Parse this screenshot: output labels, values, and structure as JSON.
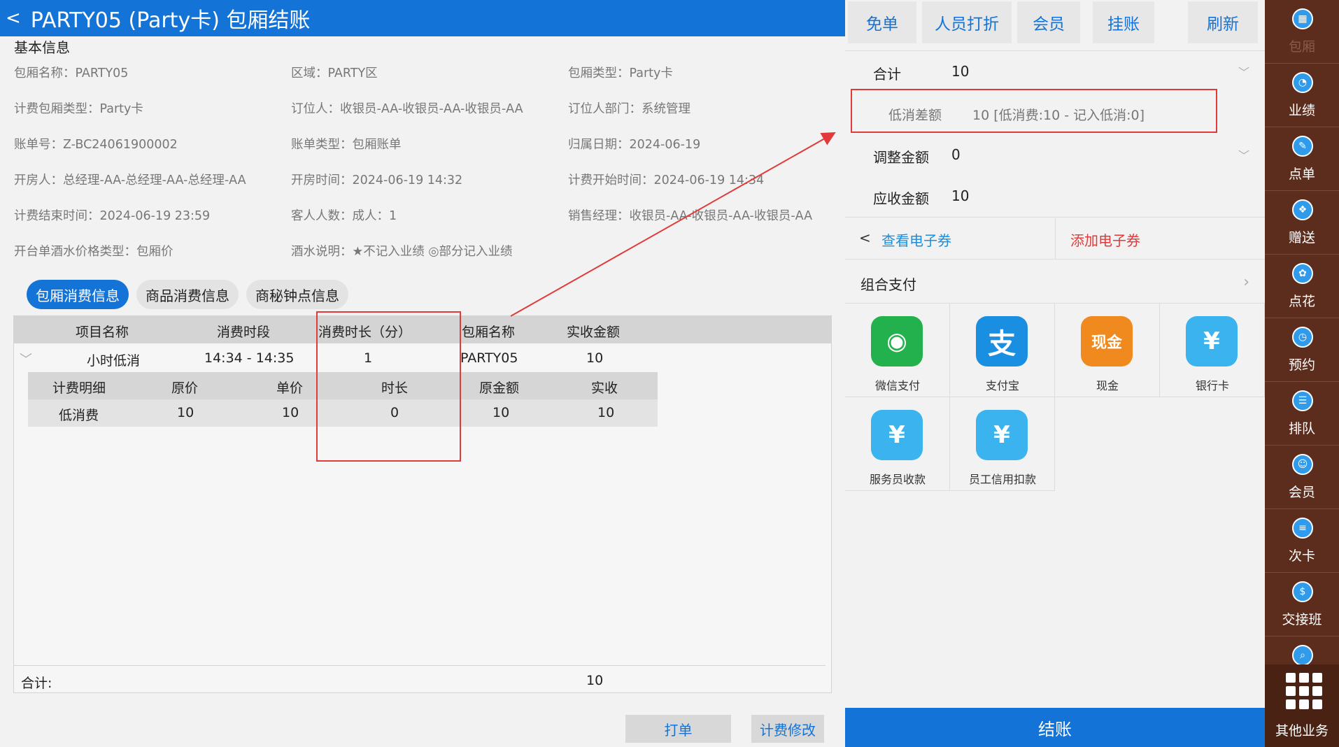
{
  "header": {
    "title": "PARTY05 (Party卡) 包厢结账"
  },
  "basic": {
    "section": "基本信息",
    "fields": [
      "包厢名称：PARTY05",
      "区域：PARTY区",
      "包厢类型：Party卡",
      "计费包厢类型：Party卡",
      "订位人：收银员-AA-收银员-AA-收银员-AA",
      "订位人部门：系统管理",
      "账单号：Z-BC24061900002",
      "账单类型：包厢账单",
      "归属日期：2024-06-19",
      "开房人：总经理-AA-总经理-AA-总经理-AA",
      "开房时间：2024-06-19 14:32",
      "计费开始时间：2024-06-19 14:34",
      "计费结束时间：2024-06-19 23:59",
      "客人人数：成人：1",
      "销售经理：收银员-AA-收银员-AA-收银员-AA",
      "开台单酒水价格类型：包厢价",
      "酒水说明：★不记入业绩 ◎部分记入业绩"
    ]
  },
  "tabs": [
    "包厢消费信息",
    "商品消费信息",
    "商秘钟点信息"
  ],
  "table": {
    "headers": [
      "项目名称",
      "消费时段",
      "消费时长（分）",
      "包厢名称",
      "实收金额"
    ],
    "row": [
      "小时低消",
      "14:34 - 14:35",
      "1",
      "PARTY05",
      "10"
    ],
    "sub_headers": [
      "计费明细",
      "原价",
      "单价",
      "时长",
      "原金额",
      "实收"
    ],
    "sub_row": [
      "低消费",
      "10",
      "10",
      "0",
      "10",
      "10"
    ],
    "total_label": "合计:",
    "total_value": "10"
  },
  "buttons": {
    "print": "打单",
    "modify": "计费修改"
  },
  "right": {
    "top_buttons": [
      "免单",
      "人员打折",
      "会员",
      "挂账",
      "刷新"
    ],
    "total_label": "合计",
    "total_value": "10",
    "diff_label": "低消差额",
    "diff_value": "10 [低消费:10 - 记入低消:0]",
    "adjust_label": "调整金额",
    "adjust_value": "0",
    "receivable_label": "应收金额",
    "receivable_value": "10",
    "view_coupon": "查看电子券",
    "add_coupon": "添加电子券",
    "combo_pay": "组合支付",
    "payments": [
      {
        "label": "微信支付",
        "color": "#22b14c",
        "glyph": "◉"
      },
      {
        "label": "支付宝",
        "color": "#1a8ee0",
        "glyph": "支"
      },
      {
        "label": "现金",
        "color": "#f08a1e",
        "glyph": "现金"
      },
      {
        "label": "银行卡",
        "color": "#3ab3ee",
        "glyph": "¥"
      },
      {
        "label": "服务员收款",
        "color": "#3ab3ee",
        "glyph": "¥"
      },
      {
        "label": "员工信用扣款",
        "color": "#3ab3ee",
        "glyph": "¥"
      }
    ],
    "checkout": "结账"
  },
  "sidebar": {
    "items": [
      "包厢",
      "业绩",
      "点单",
      "赠送",
      "点花",
      "预约",
      "排队",
      "会员",
      "次卡",
      "交接班",
      ""
    ],
    "other": "其他业务"
  }
}
